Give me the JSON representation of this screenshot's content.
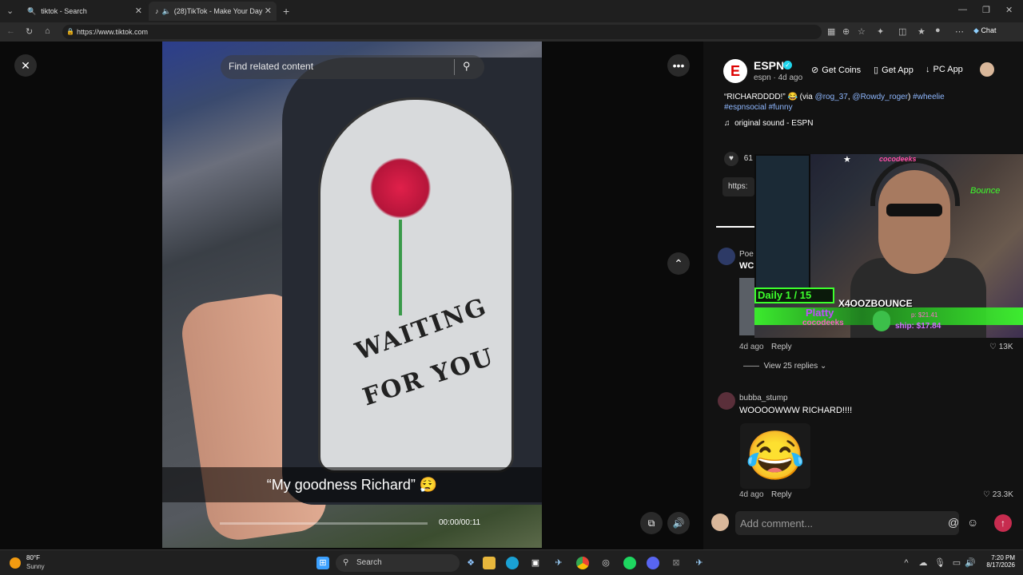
{
  "browser": {
    "tabs": [
      {
        "title": "tiktok - Search",
        "active": false
      },
      {
        "title": "(28)TikTok - Make Your Day",
        "active": true
      }
    ],
    "url": "https://www.tiktok.com",
    "chat_label": "Chat"
  },
  "video": {
    "search_placeholder": "Find related content",
    "caption": "“My goodness Richard” 😮‍💨",
    "timecode": "00:00/00:11",
    "shirt_text_1": "WAITING",
    "shirt_text_2": "FOR YOU",
    "progress": 0
  },
  "post": {
    "author": "ESPN",
    "handle_meta": "espn · 4d ago",
    "actions": [
      "Get Coins",
      "Get App",
      "PC App"
    ],
    "description_plain": "“RICHARDDDD!” 😂 (via ",
    "mention_1": "@rog_37",
    "mention_2": "@Rowdy_roger",
    "hashtag_1": "#wheelie",
    "hashtag_2": "#espnsocial",
    "hashtag_3": "#funny",
    "sound": "original sound - ESPN",
    "likes_partial": "61",
    "link_partial": "https:"
  },
  "stream_overlay": {
    "daily": "Daily 1 / 15",
    "tag": "X4OOZBOUNCE",
    "platty": "Platty",
    "cocodeeks": "cocodeeks",
    "top_name": "cocodeeks",
    "ship": "ship: $17.84",
    "money": "p: $21.41",
    "bounce": "Bounce"
  },
  "comments": [
    {
      "user_partial": "Poe",
      "text_partial": "WC",
      "meta": "4d ago",
      "reply": "Reply",
      "likes": "13K",
      "view_replies": "View 25 replies"
    },
    {
      "user": "bubba_stump",
      "text": "WOOOOWWW RICHARD!!!!",
      "meta": "4d ago",
      "reply": "Reply",
      "likes": "23.3K"
    }
  ],
  "comment_input": {
    "placeholder": "Add comment..."
  },
  "taskbar": {
    "weather_temp": "80°F",
    "weather_text": "Sunny",
    "search_label": "Search",
    "time": "7:20 PM",
    "date": "8/17/2026"
  },
  "colors": {
    "tiktok_red": "#fe2c55",
    "link_blue": "#8fb8ff",
    "overlay_green": "#3cff2c"
  }
}
